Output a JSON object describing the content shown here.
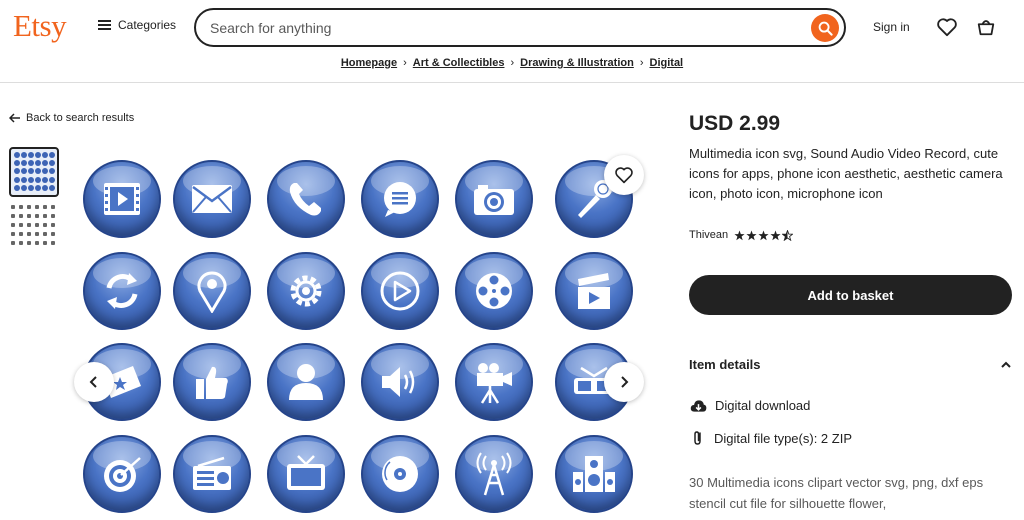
{
  "header": {
    "logo": "Etsy",
    "categories_label": "Categories",
    "search_placeholder": "Search for anything",
    "signin_label": "Sign in"
  },
  "breadcrumb": [
    "Homepage",
    "Art & Collectibles",
    "Drawing & Illustration",
    "Digital"
  ],
  "back_label": "Back to search results",
  "listing": {
    "price": "USD 2.99",
    "title": "Multimedia icon svg, Sound Audio Video Record, cute icons for apps, phone icon aesthetic, aesthetic camera icon, photo icon, microphone icon",
    "seller": "Thivean",
    "rating": 4.5,
    "add_to_basket": "Add to basket",
    "item_details_label": "Item details",
    "details": [
      "Digital download",
      "Digital file type(s): 2 ZIP"
    ],
    "description": "30 Multimedia icons clipart vector svg, png, dxf eps stencil cut file for silhouette flower,"
  },
  "image_icons": [
    "film-icon",
    "mail-icon",
    "phone-icon",
    "chat-icon",
    "camera-icon",
    "microphone-icon",
    "refresh-icon",
    "location-icon",
    "settings-icon",
    "play-icon",
    "film-reel-icon",
    "clapperboard-icon",
    "ticket-icon",
    "thumbs-up-icon",
    "user-icon",
    "speaker-icon",
    "video-camera-icon",
    "3d-glasses-icon",
    "target-icon",
    "radio-icon",
    "tv-icon",
    "disc-icon",
    "antenna-icon",
    "loudspeaker-icon"
  ],
  "colors": {
    "brand": "#f1641e",
    "icon_blue": "#4a74c6",
    "button_dark": "#222222"
  }
}
